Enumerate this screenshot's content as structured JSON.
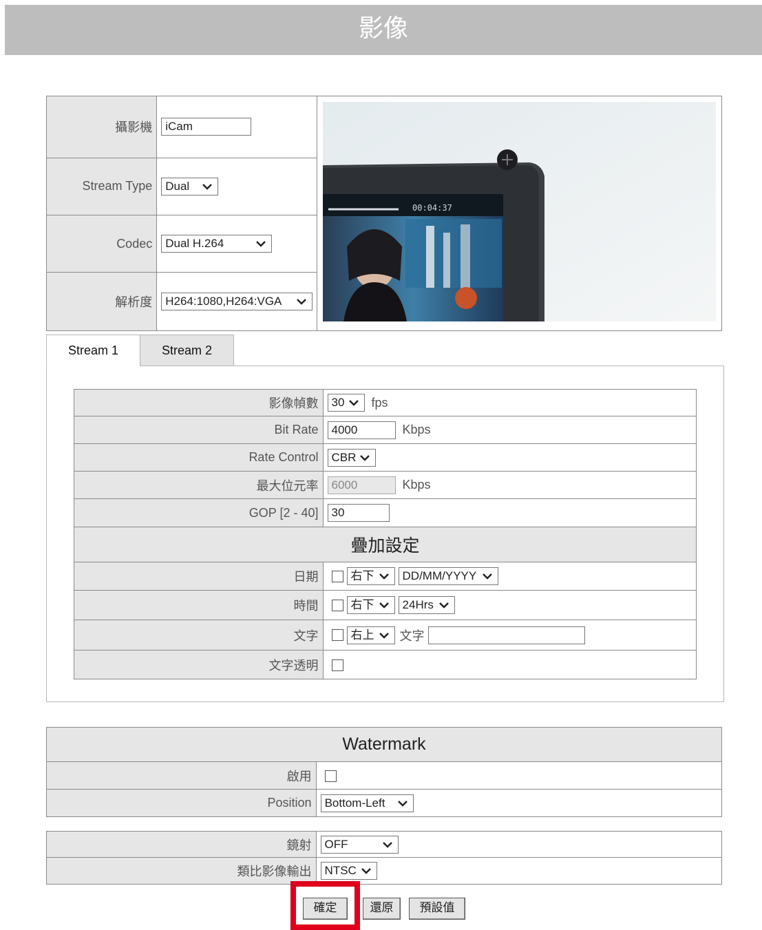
{
  "header": {
    "title": "影像"
  },
  "camera": {
    "name_label": "攝影機",
    "name_value": "iCam",
    "stream_type_label": "Stream Type",
    "stream_type_value": "Dual",
    "codec_label": "Codec",
    "codec_value": "Dual H.264",
    "resolution_label": "解析度",
    "resolution_value": "H264:1080,H264:VGA",
    "preview": {
      "timestamp": "00:04:37"
    }
  },
  "tabs": [
    {
      "label": "Stream 1",
      "active": true
    },
    {
      "label": "Stream 2",
      "active": false
    }
  ],
  "stream": {
    "fps_label": "影像幀數",
    "fps_value": "30",
    "fps_unit": "fps",
    "bitrate_label": "Bit Rate",
    "bitrate_value": "4000",
    "bitrate_unit": "Kbps",
    "rate_control_label": "Rate Control",
    "rate_control_value": "CBR",
    "max_bitrate_label": "最大位元率",
    "max_bitrate_value": "6000",
    "max_bitrate_unit": "Kbps",
    "gop_label": "GOP [2 - 40]",
    "gop_value": "30"
  },
  "overlay": {
    "title": "疊加設定",
    "date_label": "日期",
    "date_position": "右下",
    "date_format": "DD/MM/YYYY",
    "time_label": "時間",
    "time_position": "右下",
    "time_format": "24Hrs",
    "text_label": "文字",
    "text_position": "右上",
    "text_field_label": "文字",
    "text_value": "",
    "transparent_label": "文字透明"
  },
  "watermark": {
    "title": "Watermark",
    "enable_label": "啟用",
    "position_label": "Position",
    "position_value": "Bottom-Left"
  },
  "misc": {
    "mirror_label": "鏡射",
    "mirror_value": "OFF",
    "analog_label": "類比影像輸出",
    "analog_value": "NTSC"
  },
  "buttons": {
    "ok": "確定",
    "restore": "還原",
    "default": "預設值"
  },
  "colors": {
    "highlight": "#e0001b",
    "header_bg": "#bdbdbd",
    "label_bg": "#e6e6e6"
  }
}
